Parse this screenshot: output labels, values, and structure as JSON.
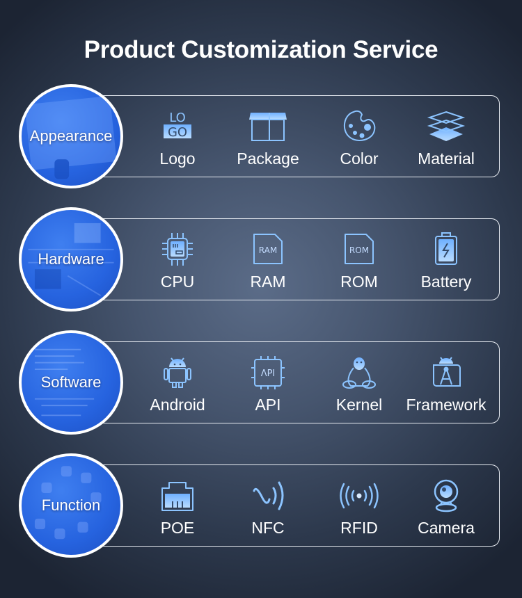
{
  "title": "Product Customization Service",
  "colors": {
    "accent": "#8cc4ff",
    "circle_blue": "#2663df",
    "border": "#e9edf3"
  },
  "sections": [
    {
      "label": "Appearance",
      "items": [
        {
          "label": "Logo",
          "icon": "logo-icon",
          "logo_top": "LO",
          "logo_bottom": "GO"
        },
        {
          "label": "Package",
          "icon": "package-box-icon"
        },
        {
          "label": "Color",
          "icon": "palette-icon"
        },
        {
          "label": "Material",
          "icon": "layers-icon"
        }
      ]
    },
    {
      "label": "Hardware",
      "items": [
        {
          "label": "CPU",
          "icon": "cpu-chip-icon"
        },
        {
          "label": "RAM",
          "icon": "ram-card-icon",
          "chip_text": "RAM"
        },
        {
          "label": "ROM",
          "icon": "rom-card-icon",
          "chip_text": "ROM"
        },
        {
          "label": "Battery",
          "icon": "battery-icon"
        }
      ]
    },
    {
      "label": "Software",
      "items": [
        {
          "label": "Android",
          "icon": "android-icon"
        },
        {
          "label": "API",
          "icon": "api-chip-icon",
          "chip_text": "ΛPI"
        },
        {
          "label": "Kernel",
          "icon": "linux-penguin-icon"
        },
        {
          "label": "Framework",
          "icon": "android-studio-icon"
        }
      ]
    },
    {
      "label": "Function",
      "items": [
        {
          "label": "POE",
          "icon": "ethernet-port-icon"
        },
        {
          "label": "NFC",
          "icon": "nfc-icon"
        },
        {
          "label": "RFID",
          "icon": "rfid-signal-icon"
        },
        {
          "label": "Camera",
          "icon": "webcam-icon"
        }
      ]
    }
  ]
}
